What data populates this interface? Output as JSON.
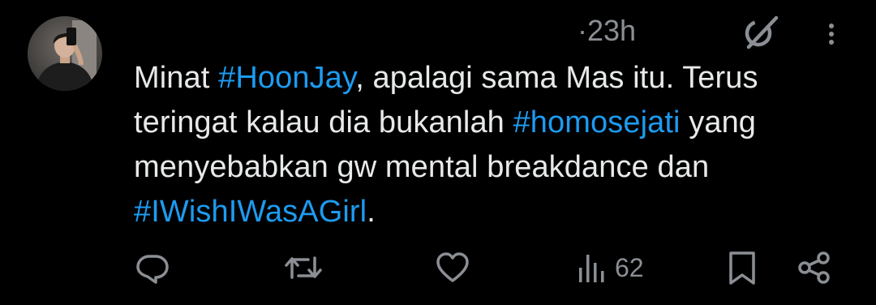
{
  "tweet": {
    "time": "23h",
    "lines": [
      [
        {
          "t": "Minat ",
          "h": false
        },
        {
          "t": "#HoonJay",
          "h": true
        },
        {
          "t": ", apalagi sama Mas itu. Terus",
          "h": false
        }
      ],
      [
        {
          "t": "teringat kalau dia bukanlah ",
          "h": false
        },
        {
          "t": "#homosejati",
          "h": true
        },
        {
          "t": " yang",
          "h": false
        }
      ],
      [
        {
          "t": "menyebabkan gw mental breakdance dan",
          "h": false
        }
      ],
      [
        {
          "t": "#IWishIWasAGirl",
          "h": true
        },
        {
          "t": ".",
          "h": false
        }
      ]
    ]
  },
  "actions": {
    "reply_icon": "reply-icon",
    "retweet_icon": "retweet-icon",
    "like_icon": "heart-icon",
    "views_icon": "views-icon",
    "views_count": "62",
    "bookmark_icon": "bookmark-icon",
    "share_icon": "share-icon"
  },
  "colors": {
    "background": "#000000",
    "text": "#e7e9ea",
    "muted": "#8b8f94",
    "hashtag": "#1d9bf0"
  }
}
